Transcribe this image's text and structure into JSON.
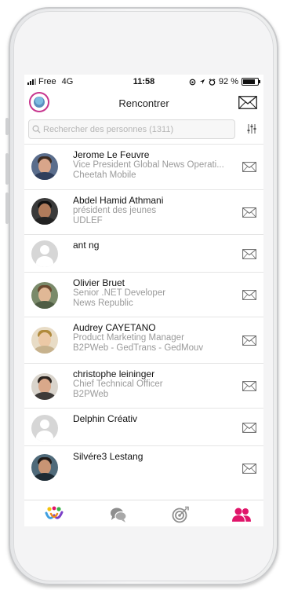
{
  "status_bar": {
    "carrier": "Free",
    "network": "4G",
    "time": "11:58",
    "battery": "92 %"
  },
  "nav": {
    "title": "Rencontrer"
  },
  "search": {
    "placeholder": "Rechercher des personnes (1311)"
  },
  "people": [
    {
      "name": "Jerome Le Feuvre",
      "line1": "Vice President Global News Operati...",
      "line2": "Cheetah Mobile",
      "avatar": "photo"
    },
    {
      "name": "Abdel Hamid Athmani",
      "line1": "président des jeunes",
      "line2": "UDLEF",
      "avatar": "photo"
    },
    {
      "name": "ant ng",
      "line1": "",
      "line2": "",
      "avatar": "placeholder"
    },
    {
      "name": "Olivier Bruet",
      "line1": "Senior .NET Developer",
      "line2": "News Republic",
      "avatar": "photo"
    },
    {
      "name": "Audrey CAYETANO",
      "line1": "Product Marketing Manager",
      "line2": "B2PWeb - GedTrans - GedMouv",
      "avatar": "photo"
    },
    {
      "name": "christophe leininger",
      "line1": "Chief Technical Officer",
      "line2": "B2PWeb",
      "avatar": "photo"
    },
    {
      "name": "Delphin Créativ",
      "line1": "",
      "line2": "",
      "avatar": "placeholder"
    },
    {
      "name": "Silvére3 Lestang",
      "line1": "",
      "line2": "",
      "avatar": "photo"
    }
  ],
  "tabs": [
    {
      "icon": "people-logo-icon",
      "active": false
    },
    {
      "icon": "chat-bubbles-icon",
      "active": false
    },
    {
      "icon": "target-icon",
      "active": false
    },
    {
      "icon": "contacts-icon",
      "active": true
    }
  ],
  "colors": {
    "accent": "#e0156a",
    "inactive_icon": "#8e8e8e",
    "mail_icon": "#666666"
  }
}
